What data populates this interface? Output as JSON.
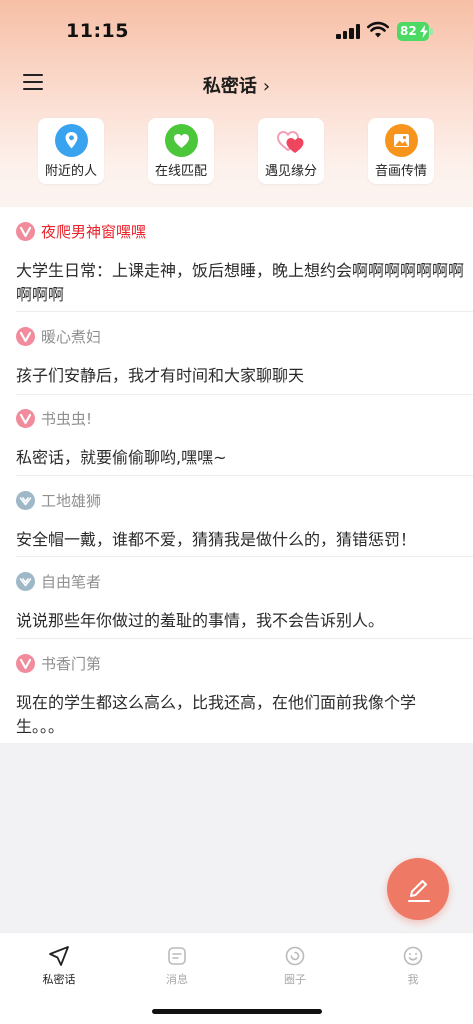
{
  "status_bar": {
    "time": "11:15",
    "battery": "82"
  },
  "header": {
    "title": "私密话",
    "chevron": "›"
  },
  "quick_actions": [
    {
      "label": "附近的人",
      "icon": "location-pin-icon",
      "color": "#3aa3f0"
    },
    {
      "label": "在线匹配",
      "icon": "heart-icon",
      "color": "#4cc63a"
    },
    {
      "label": "遇见缘分",
      "icon": "double-heart-icon",
      "color": "#f36a86"
    },
    {
      "label": "音画传情",
      "icon": "image-icon",
      "color": "#f7941d"
    }
  ],
  "posts": [
    {
      "author": "夜爬男神窗嘿嘿",
      "badge": "female-badge-icon",
      "text": "大学生日常：上课走神，饭后想睡，晚上想约会啊啊啊啊啊啊啊啊啊啊"
    },
    {
      "author": "暖心煮妇",
      "badge": "female-badge-icon",
      "text": "孩子们安静后，我才有时间和大家聊聊天"
    },
    {
      "author": "书虫虫!",
      "badge": "female-badge-icon",
      "text": "私密话，就要偷偷聊哟,嘿嘿~"
    },
    {
      "author": "工地雄狮",
      "badge": "male-badge-icon",
      "text": "安全帽一戴，谁都不爱，猜猜我是做什么的，猜错惩罚！"
    },
    {
      "author": "自由笔者",
      "badge": "male-badge-icon",
      "text": "说说那些年你做过的羞耻的事情，我不会告诉别人。"
    },
    {
      "author": "书香门第",
      "badge": "female-badge-icon",
      "text": "现在的学生都这么高么，比我还高，在他们面前我像个学生。。。"
    }
  ],
  "tabs": [
    {
      "label": "私密话",
      "icon": "send-icon",
      "active": true
    },
    {
      "label": "消息",
      "icon": "message-icon",
      "active": false
    },
    {
      "label": "圈子",
      "icon": "circle-icon",
      "active": false
    },
    {
      "label": "我",
      "icon": "smile-icon",
      "active": false
    }
  ],
  "colors": {
    "accent": "#ee7a66",
    "highlight_author": "#e8232c",
    "female_badge": "#f28b9b",
    "male_badge": "#9fb8c8"
  }
}
